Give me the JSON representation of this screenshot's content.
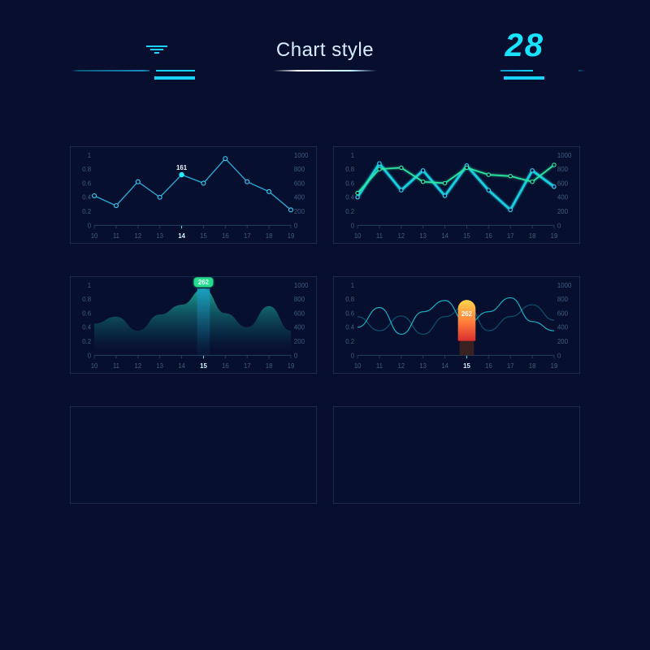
{
  "header": {
    "title": "Chart style",
    "number": "28"
  },
  "panels": [
    {
      "id": "line-points",
      "row": 0,
      "col": 0
    },
    {
      "id": "line-dual",
      "row": 0,
      "col": 1
    },
    {
      "id": "area-highlight",
      "row": 1,
      "col": 0
    },
    {
      "id": "wave-highlight",
      "row": 1,
      "col": 1
    },
    {
      "id": "empty-a",
      "row": 2,
      "col": 0
    },
    {
      "id": "empty-b",
      "row": 2,
      "col": 1
    }
  ],
  "axis": {
    "x_ticks": [
      10,
      11,
      12,
      13,
      14,
      15,
      16,
      17,
      18,
      19
    ],
    "y_left": [
      0,
      0.2,
      0.4,
      0.6,
      0.8,
      1
    ],
    "y_right": [
      0,
      200,
      400,
      600,
      800,
      1000
    ]
  },
  "chart_data": [
    {
      "id": "line-points",
      "type": "line",
      "x": [
        10,
        11,
        12,
        13,
        14,
        15,
        16,
        17,
        18,
        19
      ],
      "series": [
        {
          "name": "series-a",
          "values": [
            0.42,
            0.28,
            0.62,
            0.4,
            0.72,
            0.6,
            0.95,
            0.62,
            0.48,
            0.22
          ]
        }
      ],
      "callout": {
        "x": 14,
        "value": "161"
      },
      "highlight_x": 14,
      "y_left": [
        0,
        1
      ],
      "y_right": [
        0,
        1000
      ]
    },
    {
      "id": "line-dual",
      "type": "line",
      "x": [
        10,
        11,
        12,
        13,
        14,
        15,
        16,
        17,
        18,
        19
      ],
      "series": [
        {
          "name": "blue",
          "values": [
            0.4,
            0.88,
            0.5,
            0.78,
            0.42,
            0.85,
            0.5,
            0.22,
            0.78,
            0.55
          ]
        },
        {
          "name": "green",
          "values": [
            0.46,
            0.8,
            0.82,
            0.62,
            0.6,
            0.82,
            0.72,
            0.7,
            0.62,
            0.86
          ]
        }
      ],
      "y_left": [
        0,
        1
      ],
      "y_right": [
        0,
        1000
      ]
    },
    {
      "id": "area-highlight",
      "type": "area",
      "x": [
        10,
        11,
        12,
        13,
        14,
        15,
        16,
        17,
        18,
        19
      ],
      "series": [
        {
          "name": "area",
          "values": [
            0.45,
            0.55,
            0.35,
            0.58,
            0.72,
            0.95,
            0.6,
            0.4,
            0.7,
            0.35
          ]
        }
      ],
      "callout": {
        "x": 15,
        "value": "262"
      },
      "highlight_x": 15,
      "y_left": [
        0,
        1
      ],
      "y_right": [
        0,
        1000
      ]
    },
    {
      "id": "wave-highlight",
      "type": "line",
      "x": [
        10,
        11,
        12,
        13,
        14,
        15,
        16,
        17,
        18,
        19
      ],
      "series": [
        {
          "name": "wave-a",
          "values": [
            0.4,
            0.68,
            0.3,
            0.62,
            0.78,
            0.45,
            0.62,
            0.82,
            0.48,
            0.35
          ]
        },
        {
          "name": "wave-b",
          "values": [
            0.55,
            0.35,
            0.56,
            0.3,
            0.55,
            0.72,
            0.35,
            0.55,
            0.72,
            0.5
          ]
        }
      ],
      "callout": {
        "x": 15,
        "value": "262"
      },
      "highlight_x": 15,
      "y_left": [
        0,
        1
      ],
      "y_right": [
        0,
        1000
      ]
    }
  ]
}
